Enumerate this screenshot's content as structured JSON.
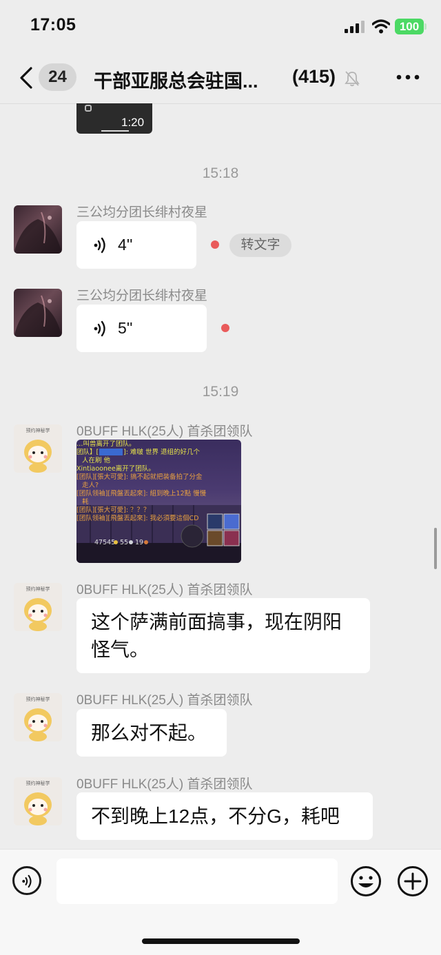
{
  "status_bar": {
    "time": "17:05",
    "battery": "100"
  },
  "header": {
    "unread_count": "24",
    "title": "干部亚服总会驻国...",
    "member_count": "(415)"
  },
  "video": {
    "duration": "1:20"
  },
  "timestamps": [
    "15:18",
    "15:19"
  ],
  "messages": [
    {
      "sender": "三公均分团长绯村夜星",
      "type": "voice",
      "duration": "4''",
      "to_text": "转文字"
    },
    {
      "sender": "三公均分团长绯村夜星",
      "type": "voice",
      "duration": "5''"
    },
    {
      "sender": "0BUFF HLK(25人) 首杀团领队",
      "type": "image",
      "image_text": {
        "line1": "…叫兽离开了团队。",
        "line2": "团队】[",
        "line2b": "]: 难啵  世界 退组的好几个",
        "line3": "人在刷 他",
        "line4": "Xintiaoonee离开了团队。",
        "line5": "[团队][張大可愛]: 搞不起就把装备拍了分金",
        "line6": "走人?",
        "line7": "[团队领袖][飛盤丟起來]: 組到晚上12點 慢慢",
        "line8": "耗",
        "line9": "[团队][張大可愛]: ？？？",
        "line10": "[团队领袖][飛盤丟起來]: 我必須要這個CD",
        "stat1": "47545",
        "stat2": "55",
        "stat3": "19"
      }
    },
    {
      "sender": "0BUFF HLK(25人) 首杀团领队",
      "type": "text",
      "lines": [
        "这个萨满前面搞事，现在阴阳",
        "怪气。"
      ]
    },
    {
      "sender": "0BUFF HLK(25人) 首杀团领队",
      "type": "text",
      "lines": [
        "那么对不起。"
      ]
    },
    {
      "sender": "0BUFF HLK(25人) 首杀团领队",
      "type": "text",
      "lines": [
        "不到晚上12点，不分G，耗吧"
      ]
    }
  ],
  "avatar_tiger_caption": "预约神秘学",
  "icons": [
    "back-icon",
    "mute-icon",
    "more-icon",
    "voice-wave-icon",
    "voice-input-icon",
    "emoji-icon",
    "plus-icon",
    "signal-icon",
    "wifi-icon"
  ]
}
